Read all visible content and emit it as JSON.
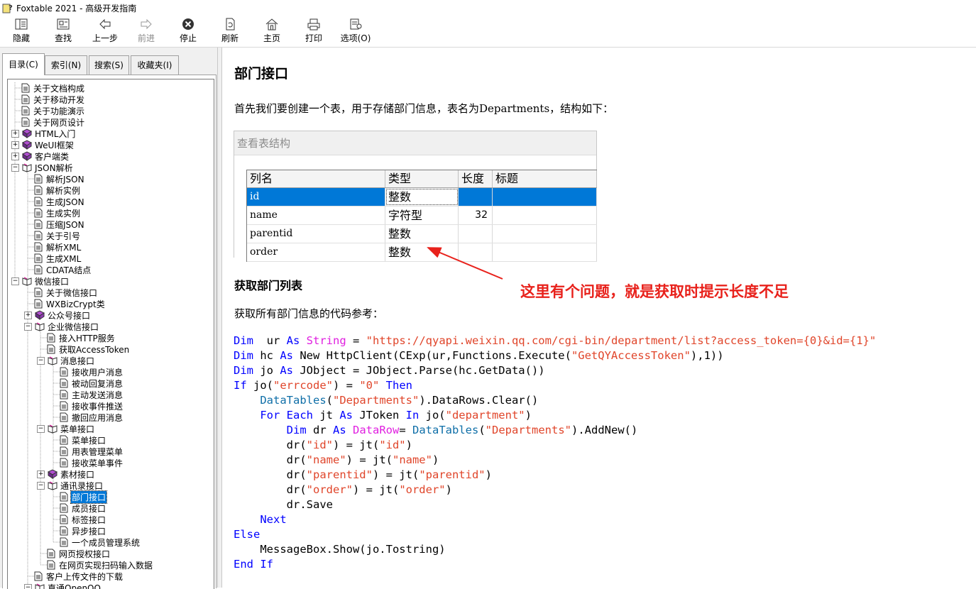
{
  "window": {
    "title": "Foxtable 2021 - 高级开发指南"
  },
  "toolbar": {
    "buttons": [
      {
        "label": "隐藏",
        "icon": "hide-pane-icon",
        "disabled": false
      },
      {
        "label": "查找",
        "icon": "locate-icon",
        "disabled": false
      },
      {
        "label": "上一步",
        "icon": "back-arrow-icon",
        "disabled": false
      },
      {
        "label": "前进",
        "icon": "forward-arrow-icon",
        "disabled": true
      },
      {
        "label": "停止",
        "icon": "stop-icon",
        "disabled": false
      },
      {
        "label": "刷新",
        "icon": "refresh-icon",
        "disabled": false
      },
      {
        "label": "主页",
        "icon": "home-icon",
        "disabled": false
      },
      {
        "label": "打印",
        "icon": "print-icon",
        "disabled": false
      },
      {
        "label": "选项(O)",
        "icon": "options-icon",
        "disabled": false
      }
    ]
  },
  "tabs": [
    "目录(C)",
    "索引(N)",
    "搜索(S)",
    "收藏夹(I)"
  ],
  "tree": [
    {
      "label": "关于文档构成",
      "type": "page",
      "level": 0
    },
    {
      "label": "关于移动开发",
      "type": "page",
      "level": 0
    },
    {
      "label": "关于功能演示",
      "type": "page",
      "level": 0
    },
    {
      "label": "关于网页设计",
      "type": "page",
      "level": 0
    },
    {
      "label": "HTML入门",
      "type": "book",
      "level": 0,
      "expander": "+"
    },
    {
      "label": "WeUI框架",
      "type": "book",
      "level": 0,
      "expander": "+"
    },
    {
      "label": "客户端类",
      "type": "book",
      "level": 0,
      "expander": "+"
    },
    {
      "label": "JSON解析",
      "type": "openbook",
      "level": 0,
      "expander": "-"
    },
    {
      "label": "解析JSON",
      "type": "page",
      "level": 1
    },
    {
      "label": "解析实例",
      "type": "page",
      "level": 1
    },
    {
      "label": "生成JSON",
      "type": "page",
      "level": 1
    },
    {
      "label": "生成实例",
      "type": "page",
      "level": 1
    },
    {
      "label": "压缩JSON",
      "type": "page",
      "level": 1
    },
    {
      "label": "关于引号",
      "type": "page",
      "level": 1
    },
    {
      "label": "解析XML",
      "type": "page",
      "level": 1
    },
    {
      "label": "生成XML",
      "type": "page",
      "level": 1
    },
    {
      "label": "CDATA结点",
      "type": "page",
      "level": 1
    },
    {
      "label": "微信接口",
      "type": "openbook",
      "level": 0,
      "expander": "-"
    },
    {
      "label": "关于微信接口",
      "type": "page",
      "level": 1
    },
    {
      "label": "WXBizCrypt类",
      "type": "page",
      "level": 1
    },
    {
      "label": "公众号接口",
      "type": "book",
      "level": 1,
      "expander": "+"
    },
    {
      "label": "企业微信接口",
      "type": "openbook",
      "level": 1,
      "expander": "-"
    },
    {
      "label": "接入HTTP服务",
      "type": "page",
      "level": 2
    },
    {
      "label": "获取AccessToken",
      "type": "page",
      "level": 2
    },
    {
      "label": "消息接口",
      "type": "openbook",
      "level": 2,
      "expander": "-"
    },
    {
      "label": "接收用户消息",
      "type": "page",
      "level": 3
    },
    {
      "label": "被动回复消息",
      "type": "page",
      "level": 3
    },
    {
      "label": "主动发送消息",
      "type": "page",
      "level": 3
    },
    {
      "label": "接收事件推送",
      "type": "page",
      "level": 3
    },
    {
      "label": "撤回应用消息",
      "type": "page",
      "level": 3
    },
    {
      "label": "菜单接口",
      "type": "openbook",
      "level": 2,
      "expander": "-"
    },
    {
      "label": "菜单接口",
      "type": "page",
      "level": 3
    },
    {
      "label": "用表管理菜单",
      "type": "page",
      "level": 3
    },
    {
      "label": "接收菜单事件",
      "type": "page",
      "level": 3
    },
    {
      "label": "素材接口",
      "type": "book",
      "level": 2,
      "expander": "+"
    },
    {
      "label": "通讯录接口",
      "type": "openbook",
      "level": 2,
      "expander": "-"
    },
    {
      "label": "部门接口",
      "type": "page",
      "level": 3,
      "selected": true
    },
    {
      "label": "成员接口",
      "type": "page",
      "level": 3
    },
    {
      "label": "标签接口",
      "type": "page",
      "level": 3
    },
    {
      "label": "异步接口",
      "type": "page",
      "level": 3
    },
    {
      "label": "一个成员管理系统",
      "type": "page",
      "level": 3
    },
    {
      "label": "网页授权接口",
      "type": "page",
      "level": 2
    },
    {
      "label": "在网页实现扫码输入数据",
      "type": "page",
      "level": 2
    },
    {
      "label": "客户上传文件的下载",
      "type": "page",
      "level": 1
    },
    {
      "label": "直通OpenQQ",
      "type": "openbook",
      "level": 1,
      "expander": "-"
    }
  ],
  "article": {
    "title": "部门接口",
    "intro": "首先我们要创建一个表，用于存储部门信息，表名为Departments，结构如下：",
    "table_caption": "查看表结构",
    "table_headers": [
      "列名",
      "类型",
      "长度",
      "标题"
    ],
    "table_rows": [
      [
        "id",
        "整数",
        "",
        ""
      ],
      [
        "name",
        "字符型",
        "32",
        ""
      ],
      [
        "parentid",
        "整数",
        "",
        ""
      ],
      [
        "order",
        "整数",
        "",
        ""
      ]
    ],
    "annotation": "这里有个问题，就是获取时提示长度不足",
    "section_title": "获取部门列表",
    "section_intro": "获取所有部门信息的代码参考：",
    "code_lines": [
      [
        [
          "kw",
          "Dim"
        ],
        [
          "",
          "  ur "
        ],
        [
          "kw",
          "As"
        ],
        [
          "",
          ""
        ],
        [
          "ty",
          " String"
        ],
        [
          "",
          " = "
        ],
        [
          "st",
          "\"https://qyapi.weixin.qq.com/cgi-bin/department/list?access_token={0}&id={1}\""
        ]
      ],
      [
        [
          "kw",
          "Dim"
        ],
        [
          "",
          " hc "
        ],
        [
          "kw",
          "As"
        ],
        [
          "",
          " New HttpClient(CExp(ur,Functions.Execute("
        ],
        [
          "st",
          "\"GetQYAccessToken\""
        ],
        [
          "",
          "),1))"
        ]
      ],
      [
        [
          "kw",
          "Dim"
        ],
        [
          "",
          " jo "
        ],
        [
          "kw",
          "As"
        ],
        [
          "",
          " JObject = JObject.Parse(hc.GetData())"
        ]
      ],
      [
        [
          "kw",
          "If"
        ],
        [
          "",
          " jo("
        ],
        [
          "st",
          "\"errcode\""
        ],
        [
          "",
          ") = "
        ],
        [
          "st",
          "\"0\""
        ],
        [
          "",
          " "
        ],
        [
          "kw",
          "Then"
        ]
      ],
      [
        [
          "",
          "    "
        ],
        [
          "tc",
          "DataTables"
        ],
        [
          "",
          "("
        ],
        [
          "st",
          "\"Departments\""
        ],
        [
          "",
          ").DataRows.Clear()"
        ]
      ],
      [
        [
          "",
          "    "
        ],
        [
          "kw",
          "For Each"
        ],
        [
          "",
          " jt "
        ],
        [
          "kw",
          "As"
        ],
        [
          "",
          " JToken "
        ],
        [
          "kw",
          "In"
        ],
        [
          "",
          " jo("
        ],
        [
          "st",
          "\"department\""
        ],
        [
          "",
          ")"
        ]
      ],
      [
        [
          "",
          "        "
        ],
        [
          "kw",
          "Dim"
        ],
        [
          "",
          " dr "
        ],
        [
          "kw",
          "As"
        ],
        [
          "",
          " "
        ],
        [
          "ty",
          "DataRow"
        ],
        [
          "",
          "= "
        ],
        [
          "tc",
          "DataTables"
        ],
        [
          "",
          "("
        ],
        [
          "st",
          "\"Departments\""
        ],
        [
          "",
          ").AddNew()"
        ]
      ],
      [
        [
          "",
          "        dr("
        ],
        [
          "st",
          "\"id\""
        ],
        [
          "",
          ") = jt("
        ],
        [
          "st",
          "\"id\""
        ],
        [
          "",
          ")"
        ]
      ],
      [
        [
          "",
          "        dr("
        ],
        [
          "st",
          "\"name\""
        ],
        [
          "",
          ") = jt("
        ],
        [
          "st",
          "\"name\""
        ],
        [
          "",
          ")"
        ]
      ],
      [
        [
          "",
          "        dr("
        ],
        [
          "st",
          "\"parentid\""
        ],
        [
          "",
          ") = jt("
        ],
        [
          "st",
          "\"parentid\""
        ],
        [
          "",
          ")"
        ]
      ],
      [
        [
          "",
          "        dr("
        ],
        [
          "st",
          "\"order\""
        ],
        [
          "",
          ") = jt("
        ],
        [
          "st",
          "\"order\""
        ],
        [
          "",
          ")"
        ]
      ],
      [
        [
          "",
          "        dr.Save"
        ]
      ],
      [
        [
          "",
          "    "
        ],
        [
          "kw",
          "Next"
        ]
      ],
      [
        [
          "kw",
          "Else"
        ]
      ],
      [
        [
          "",
          "    MessageBox.Show(jo.Tostring)"
        ]
      ],
      [
        [
          "kw",
          "End If"
        ]
      ]
    ]
  },
  "colors": {
    "selection": "#0078d7",
    "annotation": "#e8211b",
    "keyword": "#0000ff",
    "string": "#e0452a"
  }
}
